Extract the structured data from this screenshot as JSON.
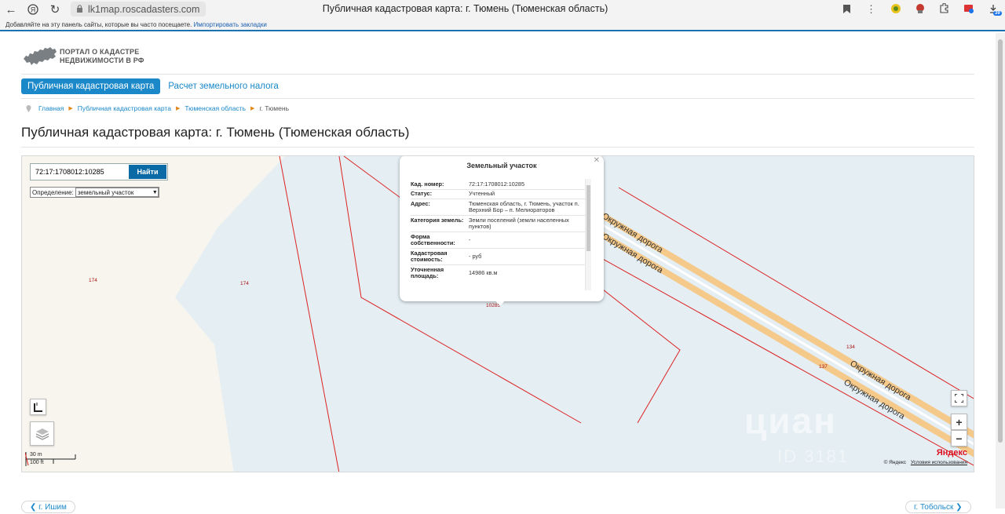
{
  "browser": {
    "url": "lk1map.roscadasters.com",
    "tab_title": "Публичная кадастровая карта: г. Тюмень (Тюменская область)",
    "bookmarks_text": "Добавляйте на эту панель сайты, которые вы часто посещаете.",
    "bookmarks_link": "Импортировать закладки",
    "badge_count": "39"
  },
  "site": {
    "logo_line1": "ПОРТАЛ О КАДАСТРЕ",
    "logo_line2": "НЕДВИЖИМОСТИ В РФ"
  },
  "tabs": {
    "active": "Публичная кадастровая карта",
    "other": "Расчет земельного налога"
  },
  "breadcrumb": [
    "Главная",
    "Публичная кадастровая карта",
    "Тюменская область",
    "г. Тюмень"
  ],
  "page_title": "Публичная кадастровая карта: г. Тюмень (Тюменская область)",
  "map": {
    "search_value": "72:17:1708012:10285",
    "search_button": "Найти",
    "definition_label": "Определение:",
    "definition_value": "земельный участок",
    "labels": {
      "parcel_a": "174",
      "parcel_b": "174",
      "parcel_c": "10285",
      "parcel_d": "134",
      "parcel_e": "137",
      "road_1": "Окружная дорога",
      "road_2": "Окружная дорога",
      "road_3": "Окружная дорога",
      "road_4": "Окружная дорога"
    },
    "scale_m": "30 m",
    "scale_ft": "100 ft",
    "yandex": "Яндекс",
    "copyright": "© Яндекс",
    "terms": "Условия использования",
    "watermark": "циан",
    "watermark_id": "ID 3181",
    "zoom_in": "+",
    "zoom_out": "−"
  },
  "popup": {
    "title": "Земельный участок",
    "rows": [
      {
        "key": "Кад. номер:",
        "value": "72:17:1708012:10285"
      },
      {
        "key": "Статус:",
        "value": "Учтенный"
      },
      {
        "key": "Адрес:",
        "value": "Тюменская область, г. Тюмень, участок п. Верхний Бор – п. Мелиораторов"
      },
      {
        "key": "Категория земель:",
        "value": "Земли поселений (земли населенных пунктов)"
      },
      {
        "key": "Форма собственности:",
        "value": "-"
      },
      {
        "key": "Кадастровая стоимость:",
        "value": "- руб"
      },
      {
        "key": "Уточненная площадь:",
        "value": "14986 кв.м"
      }
    ]
  },
  "bottom_nav": {
    "prev": "г. Ишим",
    "next": "г. Тобольск"
  }
}
